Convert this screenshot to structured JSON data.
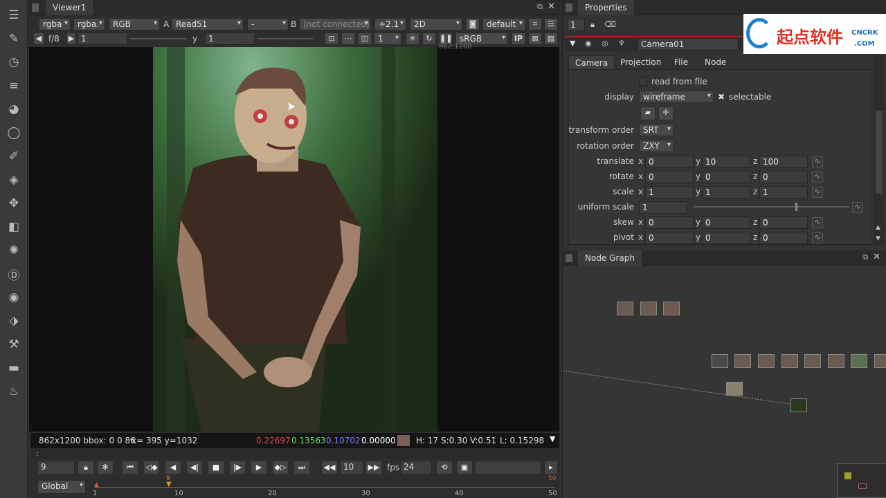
{
  "viewer": {
    "tab": "Viewer1",
    "channels": "rgba",
    "channels_alpha": "rgba.",
    "colorspace": "RGB",
    "a_label": "A",
    "a_input": "Read51",
    "mid": "-",
    "b_label": "B",
    "b_input": "(not connected)",
    "downscale": "÷2.1",
    "view_mode": "2D",
    "lut_default": "default",
    "fstop": "f/8",
    "gain": "1",
    "gamma_label": "y",
    "gamma": "1",
    "proxy": "1",
    "display_lut": "sRGB",
    "ip": "IP",
    "corner_label": "862,1200",
    "status": {
      "format": "862x1200 bbox: 0 0 8€",
      "coords": "x= 395 y=1032",
      "r": "0.22697",
      "g": "0.13563",
      "b": "0.10702",
      "a": "0.00000",
      "swatch": "#7a6058",
      "hsv": "H: 17 S:0.30 V:0.51",
      "lum": "L: 0.15298"
    },
    "command": ":"
  },
  "transport": {
    "frame": "9",
    "step": "10",
    "fps_label": "fps",
    "fps": "24",
    "range": "Global",
    "ticks": [
      "1",
      "10",
      "20",
      "30",
      "40",
      "50"
    ],
    "current_marker": "9",
    "end_marker": "50"
  },
  "properties": {
    "title": "Properties",
    "max_panels": "1",
    "node_name": "Camera01",
    "tabs": [
      "Camera",
      "Projection",
      "File",
      "Node"
    ],
    "read_from_file": "read from file",
    "display_label": "display",
    "display_value": "wireframe",
    "selectable": "selectable",
    "transform_order_label": "transform order",
    "transform_order": "SRT",
    "rotation_order_label": "rotation order",
    "rotation_order": "ZXY",
    "rows": [
      {
        "label": "translate",
        "x": "0",
        "y": "10",
        "z": "100"
      },
      {
        "label": "rotate",
        "x": "0",
        "y": "0",
        "z": "0"
      },
      {
        "label": "scale",
        "x": "1",
        "y": "1",
        "z": "1"
      }
    ],
    "uniform_scale_label": "uniform scale",
    "uniform_scale": "1",
    "rows2": [
      {
        "label": "skew",
        "x": "0",
        "y": "0",
        "z": "0"
      },
      {
        "label": "pivot",
        "x": "0",
        "y": "0",
        "z": "0"
      }
    ],
    "axis_x": "x",
    "axis_y": "y",
    "axis_z": "z"
  },
  "nodegraph": {
    "title": "Node Graph"
  },
  "watermark": {
    "main": "起点软件",
    "side_top": "CNCRK",
    "side_bottom": ".COM"
  },
  "colors": {
    "accent_red": "#e04a4a",
    "green": "#6adf6a",
    "blue": "#7a7aff"
  }
}
